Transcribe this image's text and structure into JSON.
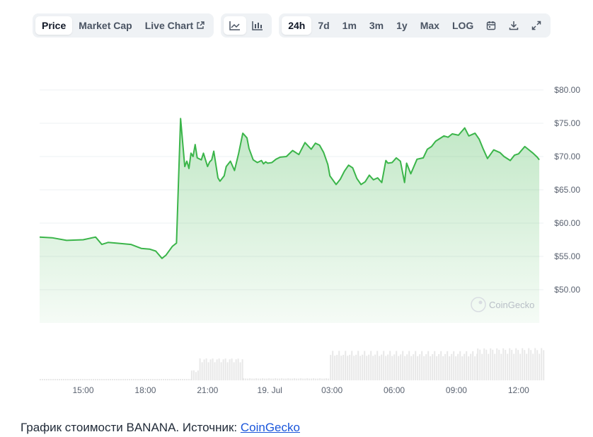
{
  "toolbar": {
    "metric_tabs": [
      {
        "label": "Price",
        "active": true
      },
      {
        "label": "Market Cap",
        "active": false
      },
      {
        "label": "Live Chart",
        "active": false,
        "icon": "external-link-icon"
      }
    ],
    "view_icons": [
      {
        "icon": "line-chart-icon",
        "active": true
      },
      {
        "icon": "candlestick-chart-icon",
        "active": false
      }
    ],
    "ranges": [
      {
        "label": "24h",
        "active": true
      },
      {
        "label": "7d",
        "active": false
      },
      {
        "label": "1m",
        "active": false
      },
      {
        "label": "3m",
        "active": false
      },
      {
        "label": "1y",
        "active": false
      },
      {
        "label": "Max",
        "active": false
      },
      {
        "label": "LOG",
        "active": false
      }
    ],
    "tool_icons": [
      "calendar-icon",
      "download-icon",
      "fullscreen-icon"
    ]
  },
  "chart_data": {
    "type": "area",
    "title": "",
    "xlabel": "",
    "ylabel": "",
    "watermark": "CoinGecko",
    "colors": {
      "line": "#3bb54a",
      "fill": "#3bb54a",
      "grid": "#eef0f3",
      "volume": "#e8e8e8",
      "axis_text": "#5a6270"
    },
    "ylim": [
      45,
      85
    ],
    "y_ticks": [
      50,
      55,
      60,
      65,
      70,
      75,
      80
    ],
    "y_tick_labels": [
      "$50.00",
      "$55.00",
      "$60.00",
      "$65.00",
      "$70.00",
      "$75.00",
      "$80.00"
    ],
    "xlim": [
      12.9,
      37.2
    ],
    "x_ticks": [
      15,
      18,
      21,
      24,
      27,
      30,
      33,
      36
    ],
    "x_tick_labels": [
      "15:00",
      "18:00",
      "21:00",
      "19. Jul",
      "03:00",
      "06:00",
      "09:00",
      "12:00"
    ],
    "price": {
      "x": [
        12.9,
        13.5,
        14.2,
        15.0,
        15.6,
        15.9,
        16.2,
        16.6,
        17.3,
        17.8,
        18.2,
        18.5,
        18.8,
        19.0,
        19.3,
        19.5,
        19.6,
        19.7,
        19.9,
        20.0,
        20.05,
        20.1,
        20.2,
        20.3,
        20.4,
        20.5,
        20.7,
        20.8,
        21.0,
        21.1,
        21.2,
        21.3,
        21.5,
        21.6,
        21.8,
        21.9,
        22.1,
        22.3,
        22.5,
        22.7,
        22.9,
        23.0,
        23.2,
        23.4,
        23.6,
        23.7,
        23.8,
        23.9,
        24.1,
        24.3,
        24.5,
        24.8,
        25.1,
        25.4,
        25.7,
        26.0,
        26.2,
        26.4,
        26.6,
        26.8,
        26.9,
        27.2,
        27.4,
        27.6,
        27.8,
        28.0,
        28.2,
        28.4,
        28.6,
        28.8,
        29.0,
        29.2,
        29.4,
        29.6,
        29.7,
        29.9,
        30.1,
        30.3,
        30.5,
        30.6,
        30.8,
        31.1,
        31.4,
        31.6,
        31.8,
        32.0,
        32.2,
        32.4,
        32.6,
        32.8,
        33.1,
        33.4,
        33.6,
        33.9,
        34.1,
        34.3,
        34.5,
        34.8,
        35.1,
        35.3,
        35.6,
        35.8,
        36.0,
        36.3,
        36.5,
        36.7,
        36.9,
        37.0
      ],
      "y": [
        57.9,
        57.8,
        57.4,
        57.5,
        57.9,
        56.8,
        57.1,
        57.0,
        56.8,
        56.2,
        56.1,
        55.8,
        54.7,
        55.2,
        56.5,
        57.0,
        66.5,
        75.7,
        68.5,
        69.3,
        68.8,
        68.2,
        70.5,
        70.0,
        71.8,
        69.8,
        69.5,
        70.5,
        68.5,
        69.2,
        69.5,
        70.8,
        66.8,
        66.3,
        67.1,
        68.5,
        69.3,
        67.9,
        70.5,
        73.5,
        72.8,
        71.2,
        69.5,
        69.1,
        69.4,
        68.9,
        69.2,
        69.0,
        69.1,
        69.6,
        69.9,
        70.0,
        70.9,
        70.3,
        72.1,
        71.1,
        72.0,
        71.7,
        70.6,
        68.8,
        67.1,
        65.8,
        66.6,
        67.8,
        68.7,
        68.3,
        66.7,
        65.8,
        66.2,
        67.2,
        66.5,
        66.8,
        66.1,
        69.4,
        69.0,
        69.1,
        69.8,
        69.3,
        66.1,
        69.0,
        67.4,
        69.6,
        69.8,
        71.1,
        71.5,
        72.3,
        72.7,
        73.1,
        72.9,
        73.4,
        73.2,
        74.3,
        73.1,
        73.5,
        72.6,
        71.1,
        69.7,
        71.0,
        70.6,
        70.0,
        69.4,
        70.2,
        70.4,
        71.5,
        71.0,
        70.5,
        69.9,
        69.5
      ]
    },
    "volume": {
      "relative_levels": [
        {
          "from": 12.9,
          "to": 20.2,
          "level": 0.02
        },
        {
          "from": 20.2,
          "to": 20.6,
          "level": 0.3
        },
        {
          "from": 20.6,
          "to": 22.7,
          "level": 0.65
        },
        {
          "from": 22.7,
          "to": 26.9,
          "level": 0.06
        },
        {
          "from": 26.9,
          "to": 34.0,
          "level": 0.85
        },
        {
          "from": 34.0,
          "to": 37.2,
          "level": 0.95
        }
      ]
    }
  },
  "caption": {
    "text": "График стоимости BANANA. Источник: ",
    "link": "CoinGecko"
  }
}
